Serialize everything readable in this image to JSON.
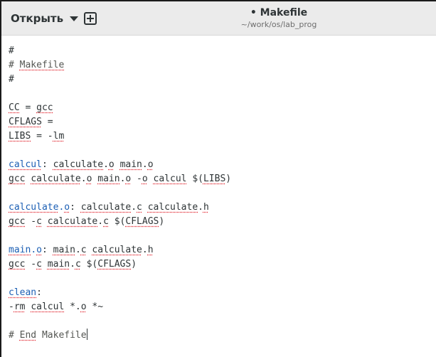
{
  "header": {
    "open_label": "Открыть",
    "title": "• Makefile",
    "path": "~/work/os/lab_prog"
  },
  "editor": {
    "lines": [
      "#",
      "# Makefile",
      "#",
      "",
      "CC = gcc",
      "CFLAGS =",
      "LIBS = -lm",
      "",
      "calcul: calculate.o main.o",
      "gcc calculate.o main.o -o calcul $(LIBS)",
      "",
      "calculate.o: calculate.c calculate.h",
      "gcc -c calculate.c $(CFLAGS)",
      "",
      "main.o: main.c calculate.h",
      "gcc -c main.c $(CFLAGS)",
      "",
      "clean:",
      "-rm calcul *.o *~",
      "",
      "# End Makefile"
    ]
  },
  "colors": {
    "headerbar": "#ebebeb",
    "text": "#2e3436",
    "target": "#1c5fb4",
    "spell_underline": "#e01b24"
  },
  "icons": [
    "caret-down-icon",
    "new-tab-icon"
  ]
}
